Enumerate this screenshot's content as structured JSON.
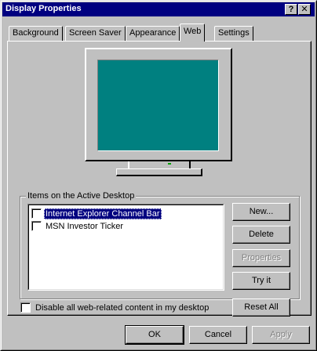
{
  "window": {
    "title": "Display Properties"
  },
  "caption_buttons": {
    "help": "?",
    "close": "✕"
  },
  "tabs": [
    {
      "label": "Background"
    },
    {
      "label": "Screen Saver"
    },
    {
      "label": "Appearance"
    },
    {
      "label": "Web",
      "active": true
    },
    {
      "label": "Settings"
    }
  ],
  "monitor": {
    "screen_color": "#008080"
  },
  "active_desktop": {
    "group_label": "Items on the Active Desktop",
    "items": [
      {
        "label": "Internet Explorer Channel Bar",
        "checked": false,
        "selected": true
      },
      {
        "label": "MSN Investor Ticker",
        "checked": false,
        "selected": false
      }
    ],
    "buttons": {
      "new": "New...",
      "delete": "Delete",
      "properties": "Properties",
      "try_it": "Try it"
    }
  },
  "disable_web_content": {
    "label": "Disable all web-related content in my desktop",
    "checked": false
  },
  "reset_all": "Reset All",
  "footer": {
    "ok": "OK",
    "cancel": "Cancel",
    "apply": "Apply"
  }
}
